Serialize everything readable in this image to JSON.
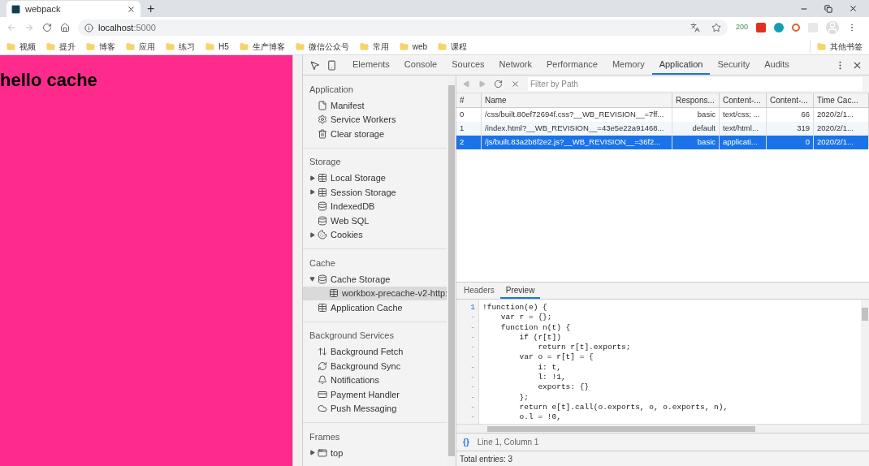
{
  "browser": {
    "tab": {
      "title": "webpack"
    },
    "new_tab": "+",
    "address": {
      "host": "localhost",
      "port": ":5000"
    },
    "extension_badge": "200",
    "bookmarks": [
      "视频",
      "提升",
      "博客",
      "应用",
      "练习",
      "H5",
      "生产博客",
      "微信公众号",
      "常用",
      "web",
      "课程"
    ],
    "other_bookmarks": "其他书签"
  },
  "page": {
    "heading": "hello cache"
  },
  "devtools": {
    "tabs": [
      {
        "label": "Elements",
        "selected": false
      },
      {
        "label": "Console",
        "selected": false
      },
      {
        "label": "Sources",
        "selected": false
      },
      {
        "label": "Network",
        "selected": false
      },
      {
        "label": "Performance",
        "selected": false
      },
      {
        "label": "Memory",
        "selected": false
      },
      {
        "label": "Application",
        "selected": true
      },
      {
        "label": "Security",
        "selected": false
      },
      {
        "label": "Audits",
        "selected": false
      }
    ],
    "sidebar": [
      {
        "title": "Application",
        "items": [
          {
            "kind": "file",
            "label": "Manifest",
            "selected": false
          },
          {
            "kind": "gear",
            "label": "Service Workers",
            "selected": false
          },
          {
            "kind": "trash",
            "label": "Clear storage",
            "selected": false
          }
        ]
      },
      {
        "title": "Storage",
        "items": [
          {
            "kind": "grid",
            "label": "Local Storage",
            "selected": false,
            "expanded": false
          },
          {
            "kind": "grid",
            "label": "Session Storage",
            "selected": false,
            "expanded": false
          },
          {
            "kind": "db",
            "label": "IndexedDB",
            "selected": false
          },
          {
            "kind": "db",
            "label": "Web SQL",
            "selected": false
          },
          {
            "kind": "cookie",
            "label": "Cookies",
            "selected": false,
            "expanded": false
          }
        ]
      },
      {
        "title": "Cache",
        "items": [
          {
            "kind": "db",
            "label": "Cache Storage",
            "selected": false,
            "expanded": true,
            "children": [
              {
                "kind": "grid",
                "label": "workbox-precache-v2-http:",
                "selected": true
              }
            ]
          },
          {
            "kind": "grid",
            "label": "Application Cache",
            "selected": false
          }
        ]
      },
      {
        "title": "Background Services",
        "items": [
          {
            "kind": "fetch",
            "label": "Background Fetch",
            "selected": false
          },
          {
            "kind": "sync",
            "label": "Background Sync",
            "selected": false
          },
          {
            "kind": "bell",
            "label": "Notifications",
            "selected": false
          },
          {
            "kind": "card",
            "label": "Payment Handler",
            "selected": false
          },
          {
            "kind": "cloud",
            "label": "Push Messaging",
            "selected": false
          }
        ]
      },
      {
        "title": "Frames",
        "items": [
          {
            "kind": "frame",
            "label": "top",
            "selected": false,
            "expanded": false
          }
        ]
      }
    ],
    "filter": {
      "placeholder": "Filter by Path"
    },
    "table": {
      "columns": [
        "#",
        "Name",
        "Respons...",
        "Content-...",
        "Content-...",
        "Time Cac..."
      ],
      "rows": [
        {
          "cells": [
            "0",
            "/css/built.80ef72694f.css?__WB_REVISION__=7ff...",
            "basic",
            "text/css; ...",
            "66",
            "2020/2/1..."
          ],
          "selected": false
        },
        {
          "cells": [
            "1",
            "/index.html?__WB_REVISION__=43e5e22a91468...",
            "default",
            "text/html...",
            "319",
            "2020/2/1..."
          ],
          "selected": false
        },
        {
          "cells": [
            "2",
            "/js/built.83a2b8f2e2.js?__WB_REVISION__=36f2...",
            "basic",
            "applicati...",
            "0",
            "2020/2/1..."
          ],
          "selected": true
        }
      ]
    },
    "preview_tabs": [
      {
        "label": "Headers",
        "selected": false
      },
      {
        "label": "Preview",
        "selected": true
      }
    ],
    "code": [
      {
        "gutter": "1",
        "text": "!function(e) {"
      },
      {
        "gutter": "-",
        "text": "    var r = {};"
      },
      {
        "gutter": "-",
        "text": "    function n(t) {"
      },
      {
        "gutter": "-",
        "text": "        if (r[t])"
      },
      {
        "gutter": "-",
        "text": "            return r[t].exports;"
      },
      {
        "gutter": "-",
        "text": "        var o = r[t] = {"
      },
      {
        "gutter": "-",
        "text": "            i: t,"
      },
      {
        "gutter": "-",
        "text": "            l: !1,"
      },
      {
        "gutter": "-",
        "text": "            exports: {}"
      },
      {
        "gutter": "-",
        "text": "        };"
      },
      {
        "gutter": "-",
        "text": "        return e[t].call(o.exports, o, o.exports, n),"
      },
      {
        "gutter": "-",
        "text": "        o.l = !0,"
      }
    ],
    "format_button": "{}",
    "cursor": "Line 1, Column 1",
    "total": "Total entries: 3"
  }
}
